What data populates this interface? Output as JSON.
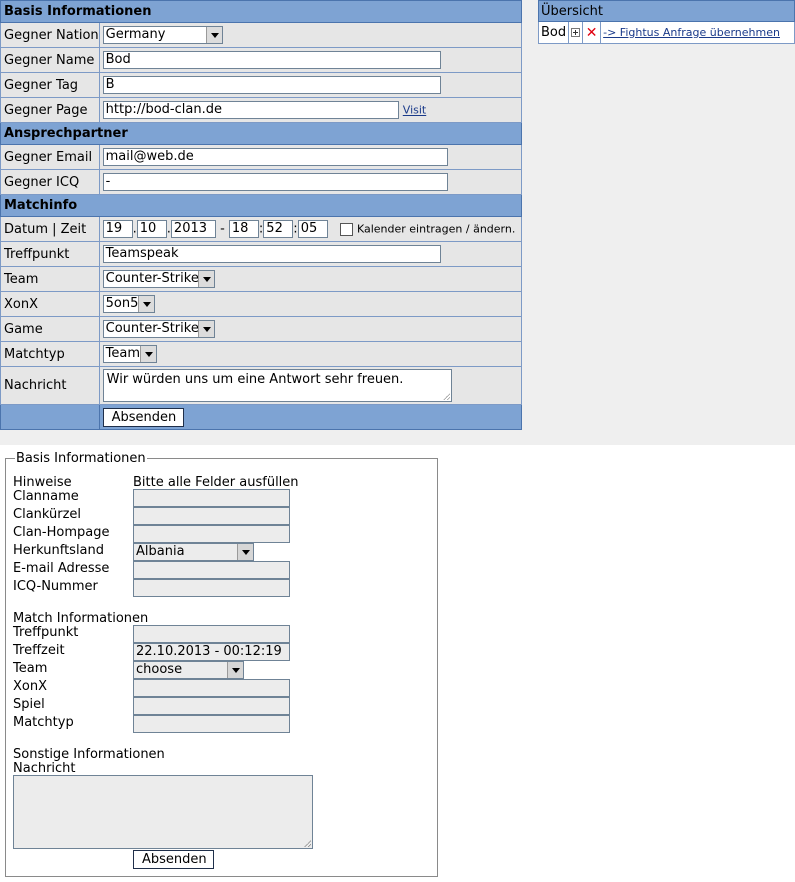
{
  "form": {
    "sections": {
      "basis": "Basis Informationen",
      "ansprech": "Ansprechpartner",
      "matchinfo": "Matchinfo"
    },
    "labels": {
      "nation": "Gegner Nation",
      "name": "Gegner Name",
      "tag": "Gegner Tag",
      "page": "Gegner Page",
      "email": "Gegner Email",
      "icq": "Gegner ICQ",
      "datum": "Datum | Zeit",
      "treffpunkt": "Treffpunkt",
      "team": "Team",
      "xonx": "XonX",
      "game": "Game",
      "matchtyp": "Matchtyp",
      "nachricht": "Nachricht"
    },
    "values": {
      "nation": "Germany",
      "name": "Bod",
      "tag": "B",
      "page": "http://bod-clan.de",
      "email": "mail@web.de",
      "icq": "-",
      "day": "19",
      "month": "10",
      "year": "2013",
      "hour": "18",
      "minute": "52",
      "second": "05",
      "treffpunkt": "Teamspeak",
      "team": "Counter-Strike",
      "xonx": "5on5",
      "game": "Counter-Strike",
      "matchtyp": "Team",
      "nachricht": "Wir würden uns um eine Antwort sehr freuen."
    },
    "sep_dot": ".",
    "sep_dash": "-",
    "sep_colon": ":",
    "visit_link": "Visit",
    "kalender_label": "Kalender eintragen / ändern.",
    "submit": "Absenden"
  },
  "overview": {
    "title": "Übersicht",
    "name": "Bod",
    "delete_glyph": "✕",
    "link": "-> Fightus Anfrage übernehmen"
  },
  "bottom": {
    "legend": "Basis Informationen",
    "hinweise_label": "Hinweise",
    "hinweise_text": "Bitte alle Felder ausfüllen",
    "labels": {
      "clanname": "Clanname",
      "clankuerzel": "Clankürzel",
      "homepage": "Clan-Hompage",
      "herkunft": "Herkunftsland",
      "email": "E-mail Adresse",
      "icq": "ICQ-Nummer",
      "match_heading": "Match Informationen",
      "treffpunkt": "Treffpunkt",
      "treffzeit": "Treffzeit",
      "team": "Team",
      "xonx": "XonX",
      "spiel": "Spiel",
      "matchtyp": "Matchtyp",
      "sonstige_heading": "Sonstige Informationen",
      "nachricht": "Nachricht"
    },
    "values": {
      "herkunft": "Albania",
      "treffzeit": "22.10.2013 - 00:12:19",
      "team": "choose"
    },
    "submit": "Absenden"
  }
}
